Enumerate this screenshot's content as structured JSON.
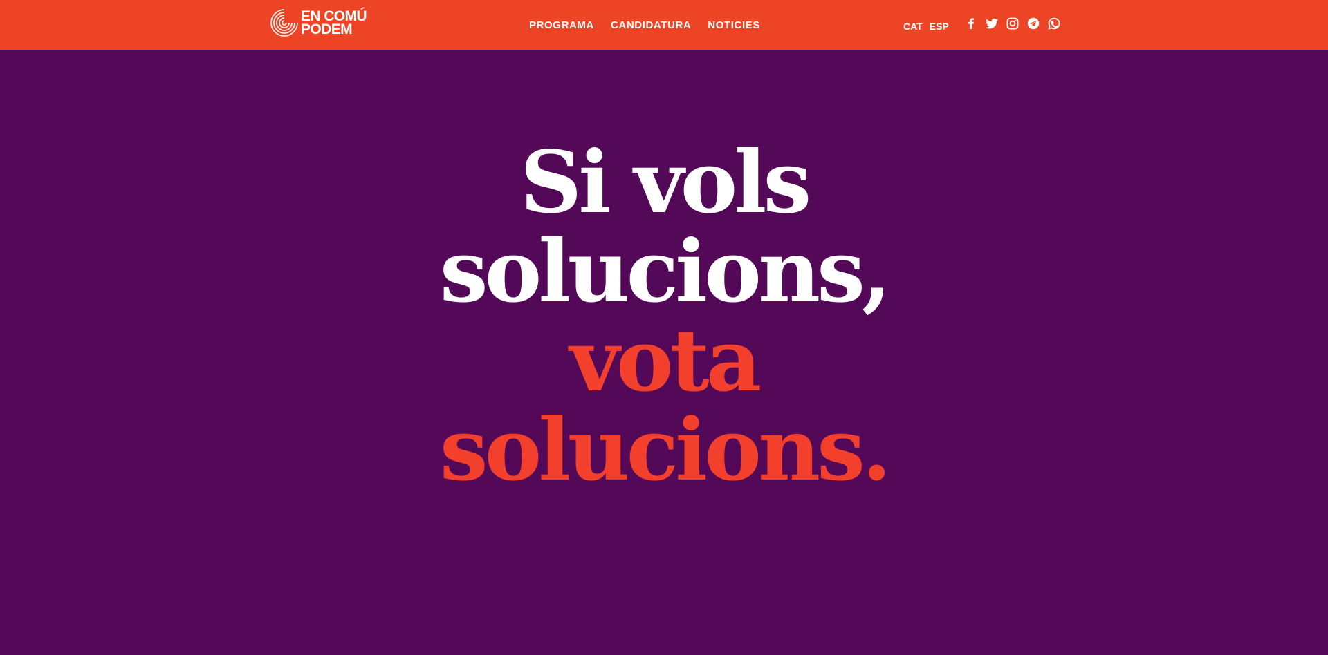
{
  "brand": {
    "line1": "EN COMÚ",
    "line2": "PODEM",
    "logo_icon": "concentric-circles-logo-icon"
  },
  "nav": {
    "items": [
      {
        "label": "PROGRAMA"
      },
      {
        "label": "CANDIDATURA"
      },
      {
        "label": "NOTICIES"
      }
    ]
  },
  "languages": [
    {
      "label": "CAT"
    },
    {
      "label": "ESP"
    }
  ],
  "social": [
    {
      "icon": "facebook-icon"
    },
    {
      "icon": "twitter-icon"
    },
    {
      "icon": "instagram-icon"
    },
    {
      "icon": "telegram-icon"
    },
    {
      "icon": "whatsapp-icon"
    }
  ],
  "hero": {
    "line1": "Si vols",
    "line2": "solucions,",
    "line3": "vota",
    "line4": "solucions."
  },
  "colors": {
    "header_bg": "#ee4426",
    "page_bg": "#540958",
    "accent_text": "#f2402c",
    "text": "#ffffff"
  }
}
